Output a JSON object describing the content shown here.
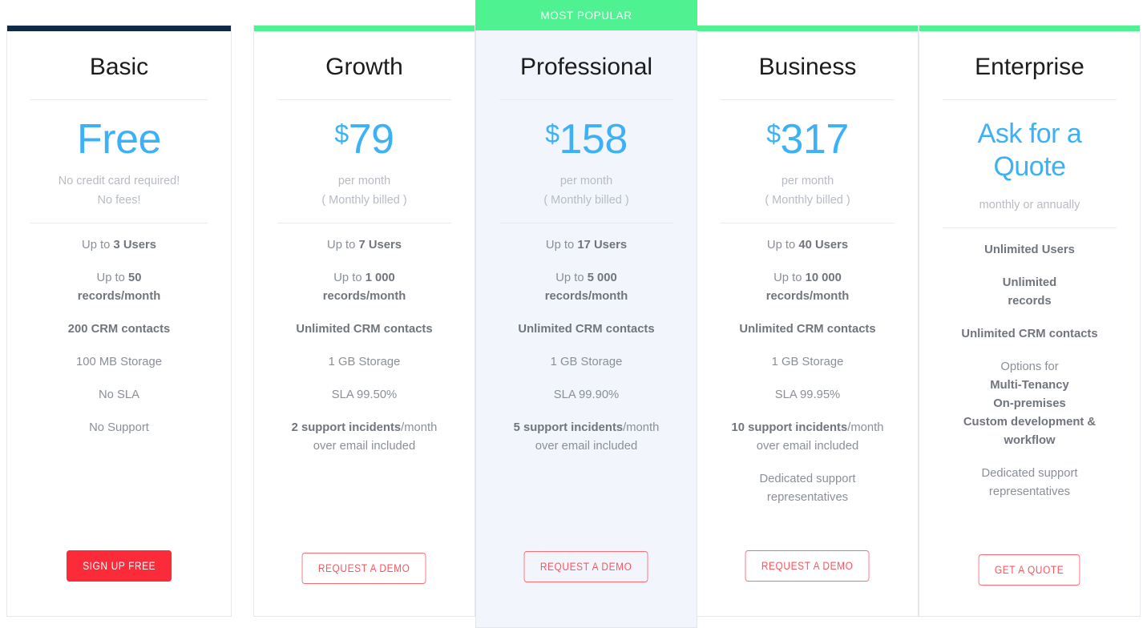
{
  "badge": {
    "most_popular": "MOST POPULAR"
  },
  "colors": {
    "accent_basic": "#0e2a47",
    "accent_green": "#4ef291",
    "price_blue": "#3cb1f5",
    "cta_red": "#fb2b3a",
    "cta_outline": "#fb5560",
    "highlight_bg": "#f2f5fc"
  },
  "plans": [
    {
      "id": "basic",
      "name": "Basic",
      "price": "Free",
      "currency": "",
      "price_note_line1": "No credit card required!",
      "price_note_line2": "No fees!",
      "features": [
        {
          "prefix": "Up to ",
          "bold": "3 Users",
          "suffix": ""
        },
        {
          "prefix": "Up to ",
          "bold": "50",
          "suffix": "",
          "line2": "records/month",
          "line2_bold": true
        },
        {
          "prefix": "",
          "bold": "200 CRM contacts",
          "suffix": ""
        },
        {
          "prefix": "100 MB Storage",
          "bold": "",
          "suffix": ""
        },
        {
          "prefix": "No SLA",
          "bold": "",
          "suffix": ""
        },
        {
          "prefix": "No Support",
          "bold": "",
          "suffix": ""
        }
      ],
      "cta": {
        "label": "SIGN UP FREE",
        "style": "solid"
      }
    },
    {
      "id": "growth",
      "name": "Growth",
      "price": "79",
      "currency": "$",
      "price_note_line1": "per month",
      "price_note_line2": "( Monthly billed )",
      "features": [
        {
          "prefix": "Up to ",
          "bold": "7 Users",
          "suffix": ""
        },
        {
          "prefix": "Up to ",
          "bold": "1 000",
          "suffix": "",
          "line2": "records/month",
          "line2_bold": true
        },
        {
          "prefix": "",
          "bold": "Unlimited CRM contacts",
          "suffix": ""
        },
        {
          "prefix": "1 GB Storage",
          "bold": "",
          "suffix": ""
        },
        {
          "prefix": "SLA 99.50%",
          "bold": "",
          "suffix": ""
        },
        {
          "prefix": "",
          "bold": "2 support incidents",
          "suffix": "/month",
          "line2": "over email included",
          "line2_bold": false
        }
      ],
      "cta": {
        "label": "REQUEST A DEMO",
        "style": "outline"
      }
    },
    {
      "id": "professional",
      "name": "Professional",
      "price": "158",
      "currency": "$",
      "price_note_line1": "per month",
      "price_note_line2": "( Monthly billed )",
      "features": [
        {
          "prefix": "Up to ",
          "bold": "17 Users",
          "suffix": ""
        },
        {
          "prefix": "Up to ",
          "bold": "5 000",
          "suffix": "",
          "line2": "records/month",
          "line2_bold": true
        },
        {
          "prefix": "",
          "bold": "Unlimited CRM contacts",
          "suffix": ""
        },
        {
          "prefix": "1 GB Storage",
          "bold": "",
          "suffix": ""
        },
        {
          "prefix": "SLA 99.90%",
          "bold": "",
          "suffix": ""
        },
        {
          "prefix": "",
          "bold": "5 support incidents",
          "suffix": "/month",
          "line2": "over email included",
          "line2_bold": false
        }
      ],
      "cta": {
        "label": "REQUEST A DEMO",
        "style": "outline"
      }
    },
    {
      "id": "business",
      "name": "Business",
      "price": "317",
      "currency": "$",
      "price_note_line1": "per month",
      "price_note_line2": "( Monthly billed )",
      "features": [
        {
          "prefix": "Up to ",
          "bold": "40 Users",
          "suffix": ""
        },
        {
          "prefix": "Up to ",
          "bold": "10 000",
          "suffix": "",
          "line2": "records/month",
          "line2_bold": true
        },
        {
          "prefix": "",
          "bold": "Unlimited CRM contacts",
          "suffix": ""
        },
        {
          "prefix": "1 GB Storage",
          "bold": "",
          "suffix": ""
        },
        {
          "prefix": "SLA 99.95%",
          "bold": "",
          "suffix": ""
        },
        {
          "prefix": "",
          "bold": "10 support incidents",
          "suffix": "/month",
          "line2": "over email included",
          "line2_bold": false
        },
        {
          "prefix": "Dedicated support",
          "bold": "",
          "suffix": "",
          "line2": "representatives",
          "line2_bold": false
        }
      ],
      "cta": {
        "label": "REQUEST A DEMO",
        "style": "outline"
      }
    },
    {
      "id": "enterprise",
      "name": "Enterprise",
      "price": "Ask for a Quote",
      "currency": "",
      "price_note_line1": "monthly or annually",
      "price_note_line2": "",
      "features": [
        {
          "prefix": "",
          "bold": "Unlimited Users",
          "suffix": ""
        },
        {
          "prefix": "",
          "bold": "Unlimited",
          "suffix": "",
          "line2": "records",
          "line2_bold": true
        },
        {
          "prefix": "",
          "bold": "Unlimited CRM contacts",
          "suffix": ""
        },
        {
          "prefix": "Options for",
          "bold": "",
          "suffix": "",
          "lines_bold": [
            "Multi-Tenancy",
            "On-premises",
            "Custom development &",
            "workflow"
          ]
        },
        {
          "prefix": "Dedicated support",
          "bold": "",
          "suffix": "",
          "line2": "representatives",
          "line2_bold": false
        }
      ],
      "cta": {
        "label": "GET A QUOTE",
        "style": "outline"
      }
    }
  ]
}
